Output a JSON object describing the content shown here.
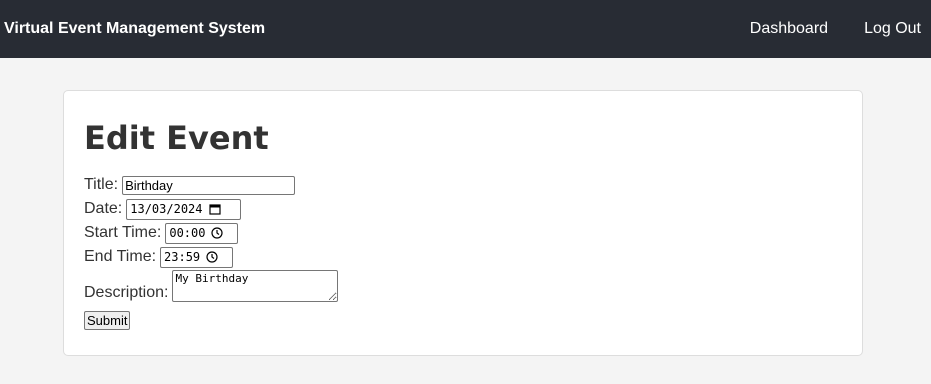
{
  "header": {
    "title": "Virtual Event Management System",
    "nav": {
      "dashboard": "Dashboard",
      "logout": "Log Out"
    }
  },
  "form": {
    "heading": "Edit Event",
    "title_label": "Title:",
    "title_value": "Birthday",
    "date_label": "Date:",
    "date_value": "13/03/2024",
    "start_label": "Start Time:",
    "start_value": "00:00",
    "end_label": "End Time:",
    "end_value": "23:59",
    "description_label": "Description:",
    "description_value": "My Birthday",
    "submit_label": "Submit"
  },
  "colors": {
    "topbar": "#282c34",
    "background": "#f4f4f4",
    "card": "#ffffff"
  }
}
